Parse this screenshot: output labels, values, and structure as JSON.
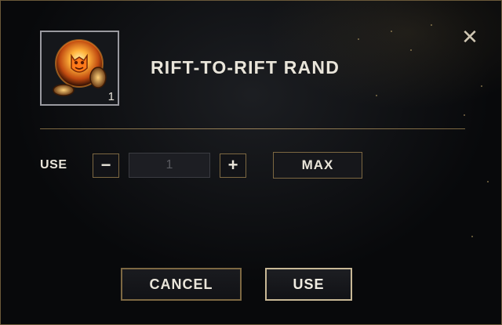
{
  "dialog": {
    "title": "RIFT-TO-RIFT RAND",
    "close_icon": "✕"
  },
  "item": {
    "icon": "rift-to-rift-orb-icon",
    "count": "1"
  },
  "use_row": {
    "label": "USE",
    "decrement_label": "−",
    "quantity_value": "1",
    "increment_label": "+",
    "max_label": "MAX"
  },
  "actions": {
    "cancel_label": "CANCEL",
    "confirm_label": "USE"
  },
  "colors": {
    "accent_gold": "#7d6842",
    "text": "#e9e5da",
    "background": "#0c0d10"
  }
}
